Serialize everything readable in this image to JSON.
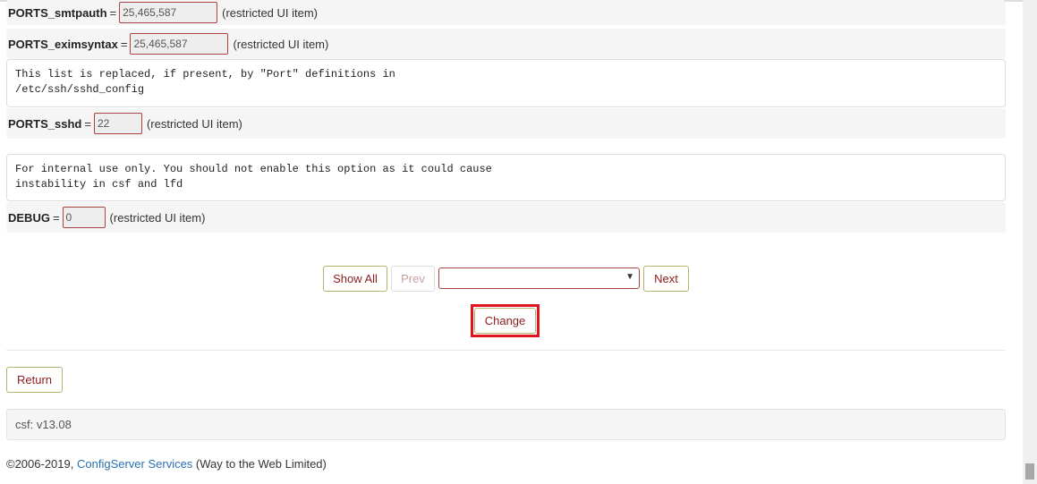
{
  "settings": [
    {
      "key": "PORTS_smtpauth",
      "value": "25,465,587",
      "note": "(restricted UI item)"
    },
    {
      "key": "PORTS_eximsyntax",
      "value": "25,465,587",
      "note": "(restricted UI item)"
    },
    {
      "key": "PORTS_sshd",
      "value": "22",
      "note": "(restricted UI item)"
    },
    {
      "key": "DEBUG",
      "value": "0",
      "note": "(restricted UI item)"
    }
  ],
  "comments": {
    "sshd": "This list is replaced, if present, by \"Port\" definitions in\n/etc/ssh/sshd_config",
    "debug": "For internal use only. You should not enable this option as it could cause\ninstability in csf and lfd"
  },
  "eq_sign": "=",
  "nav": {
    "show_all": "Show All",
    "prev": "Prev",
    "select_value": "",
    "next": "Next"
  },
  "change_label": "Change",
  "return_label": "Return",
  "version": "csf: v13.08",
  "copyright": {
    "prefix": "©2006-2019, ",
    "link": "ConfigServer Services",
    "suffix": " (Way to the Web Limited)"
  },
  "colors": {
    "accent_red": "#a94442",
    "highlight": "#e0141e",
    "link": "#2a6fb0"
  }
}
